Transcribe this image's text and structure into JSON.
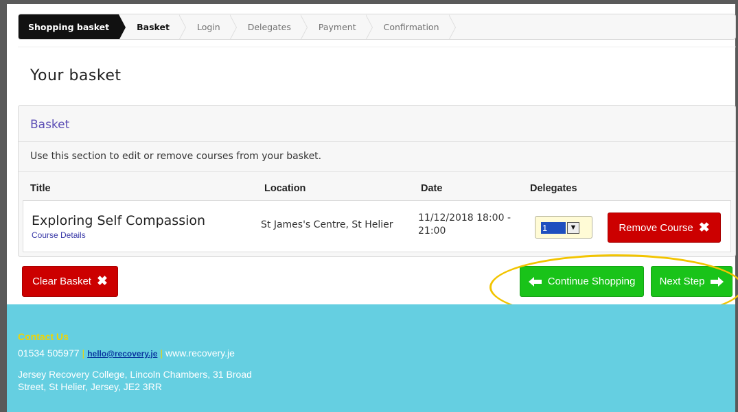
{
  "steps": [
    {
      "label": "Shopping basket"
    },
    {
      "label": "Basket"
    },
    {
      "label": "Login"
    },
    {
      "label": "Delegates"
    },
    {
      "label": "Payment"
    },
    {
      "label": "Confirmation"
    }
  ],
  "page_title": "Your basket",
  "panel": {
    "title": "Basket",
    "description": "Use this section to edit or remove courses from your basket."
  },
  "table": {
    "headers": {
      "title": "Title",
      "location": "Location",
      "date": "Date",
      "delegates": "Delegates"
    },
    "rows": [
      {
        "title": "Exploring Self Compassion",
        "details_link": "Course Details",
        "location": "St James's Centre, St Helier",
        "date_line1": "11/12/2018 18:00 -",
        "date_line2": "21:00",
        "delegates_selected": "1",
        "remove_label": "Remove Course"
      }
    ]
  },
  "buttons": {
    "clear_basket": "Clear Basket",
    "continue_shopping": "Continue Shopping",
    "next_step": "Next Step"
  },
  "footer": {
    "contact_title": "Contact Us",
    "phone": "01534 505977",
    "email": "hello@recovery.je",
    "website": "www.recovery.je",
    "address": "Jersey Recovery College, Lincoln Chambers, 31 Broad Street, St Helier, Jersey, JE2 3RR"
  },
  "colors": {
    "danger": "#cc0000",
    "success": "#19c319",
    "footer_bg": "#65cfe1",
    "accent_yellow": "#f2c400",
    "panel_title": "#5b4db5"
  }
}
